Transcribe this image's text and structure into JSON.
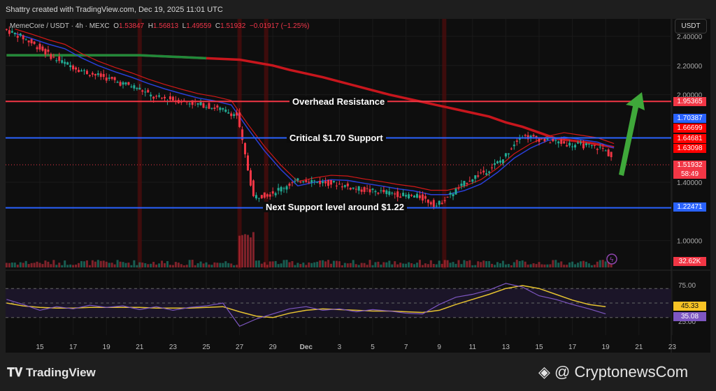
{
  "header": {
    "credit": "Shattry created with TradingView.com, Dec 19, 2025 11:01 UTC"
  },
  "legend": {
    "symbol": "MemeCore / USDT · 4h · MEXC",
    "o_label": "O",
    "o": "1.53847",
    "h_label": "H",
    "h": "1.56813",
    "l_label": "L",
    "l": "1.49559",
    "c_label": "C",
    "c": "1.51932",
    "change": "−0.01917 (−1.25%)"
  },
  "currency_button": "USDT",
  "price_tags": [
    {
      "value": "1.95365",
      "color": "#f23645"
    },
    {
      "value": "1.70387",
      "color": "#2962ff"
    },
    {
      "value": "1.66699",
      "color": "#ff0000"
    },
    {
      "value": "1.64681",
      "color": "#ff0000"
    },
    {
      "value": "1.63098",
      "color": "#ff0000"
    },
    {
      "value": "1.51932",
      "color": "#f23645"
    },
    {
      "value": "1.22471",
      "color": "#2962ff"
    }
  ],
  "countdown": "58:49",
  "volume_tag": "32.62K",
  "rsi_tags": {
    "ma": "45.33",
    "rsi": "35.08"
  },
  "footer": {
    "brand": "TradingView",
    "watermark": "@ CryptonewsCom"
  },
  "chart_data": {
    "type": "candlestick",
    "title": "MemeCore / USDT · 4h · MEXC",
    "ylim": [
      0.92,
      2.48
    ],
    "y_ticks": [
      "2.40000",
      "2.20000",
      "2.00000",
      "1.40000",
      "1.00000"
    ],
    "y_tick_values": [
      2.4,
      2.2,
      2.0,
      1.4,
      1.0
    ],
    "x_ticks": [
      "3",
      "15",
      "17",
      "19",
      "21",
      "23",
      "25",
      "27",
      "29",
      "Dec",
      "3",
      "5",
      "7",
      "9",
      "11",
      "13",
      "15",
      "17",
      "19",
      "21",
      "23"
    ],
    "x_tick_days": [
      -2,
      2,
      4,
      6,
      8,
      10,
      12,
      14,
      16,
      18,
      20,
      22,
      24,
      26,
      28,
      30,
      32,
      34,
      36,
      38,
      40
    ],
    "days_from_nov13": [
      0,
      1,
      2,
      3,
      4,
      5,
      6,
      7,
      8,
      9,
      10,
      11,
      12,
      13,
      14,
      15,
      16,
      17,
      18,
      19,
      20,
      21,
      22,
      23,
      24,
      25,
      26,
      27,
      28,
      29,
      30,
      31,
      32,
      33,
      34,
      35,
      36
    ],
    "daily_close": [
      2.4,
      2.33,
      2.25,
      2.2,
      2.15,
      2.12,
      2.08,
      2.05,
      1.98,
      1.97,
      1.95,
      1.93,
      1.9,
      1.86,
      1.3,
      1.32,
      1.38,
      1.42,
      1.4,
      1.39,
      1.36,
      1.34,
      1.33,
      1.31,
      1.3,
      1.24,
      1.33,
      1.42,
      1.48,
      1.56,
      1.72,
      1.7,
      1.68,
      1.66,
      1.65,
      1.63,
      1.52
    ],
    "ma_long": [
      2.27,
      2.27,
      2.27,
      2.27,
      2.26,
      2.25,
      2.24,
      2.22,
      2.2,
      2.17,
      2.12,
      2.06,
      2.0,
      1.95,
      1.9,
      1.85,
      1.81,
      1.78,
      1.74,
      1.7,
      1.67,
      1.64
    ],
    "ma_long_days": [
      0,
      3,
      6,
      8,
      10,
      12,
      14,
      15,
      16,
      17,
      19,
      21,
      23,
      25,
      27,
      29,
      30,
      31,
      32,
      33,
      35,
      36.5
    ],
    "horizontal_levels": [
      {
        "label": "Overhead Resistance",
        "value": 1.95365,
        "color": "#f23645"
      },
      {
        "label": "Critical $1.70 Support",
        "value": 1.70387,
        "color": "#2962ff"
      },
      {
        "label": "Next Support level around $1.22",
        "value": 1.22471,
        "color": "#2962ff"
      }
    ],
    "rsi": {
      "levels": [
        "75.00",
        "25.00"
      ],
      "level_values": [
        75,
        25
      ],
      "last_rsi": 35.08,
      "last_ma": 45.33,
      "rsi_series": [
        55,
        48,
        40,
        45,
        42,
        47,
        44,
        46,
        41,
        45,
        40,
        44,
        46,
        50,
        18,
        28,
        35,
        42,
        45,
        40,
        42,
        38,
        41,
        39,
        36,
        35,
        48,
        58,
        62,
        68,
        77,
        72,
        60,
        55,
        48,
        42,
        35
      ],
      "ma_series": [
        50,
        46,
        44,
        43,
        43,
        44,
        44,
        44,
        44,
        43,
        43,
        43,
        44,
        45,
        38,
        32,
        30,
        36,
        40,
        42,
        41,
        40,
        39,
        39,
        38,
        37,
        40,
        48,
        55,
        62,
        70,
        74,
        70,
        62,
        54,
        48,
        45
      ]
    }
  }
}
